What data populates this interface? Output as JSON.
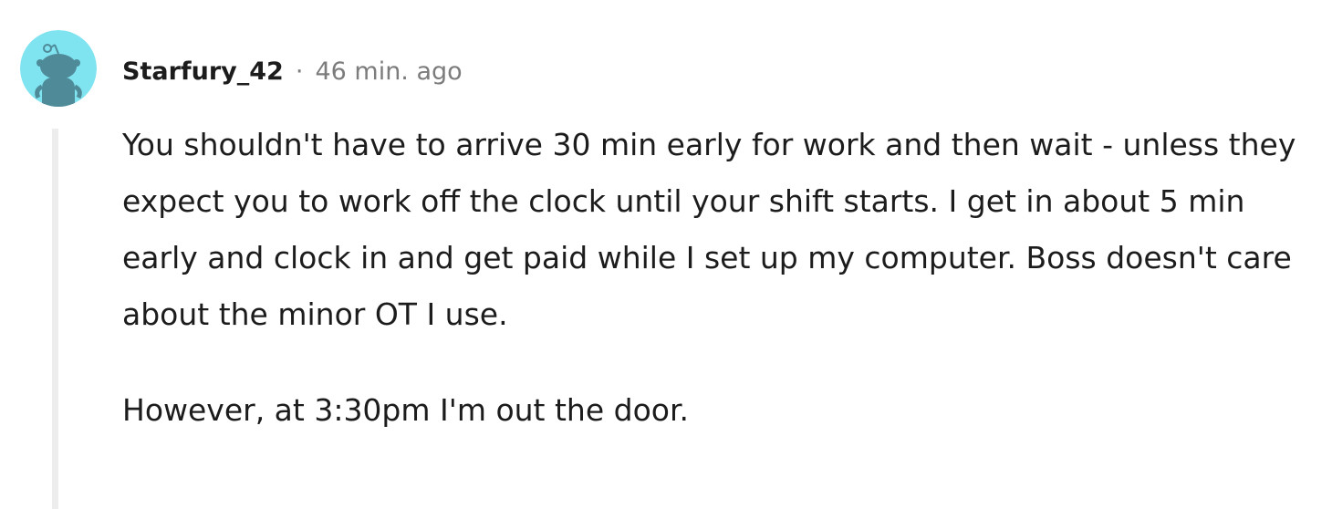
{
  "comment": {
    "author": "Starfury_42",
    "separator": "·",
    "timestamp": "46 min. ago",
    "avatar": {
      "icon": "snoo-avatar-icon",
      "background_color": "#7fe3f0",
      "figure_color": "#4f8a99"
    },
    "paragraphs": [
      "You shouldn't have to arrive 30 min early for work and then wait - unless they expect you to work off the clock until your shift starts. I get in about 5 min early and clock in and get paid while I set up my computer. Boss doesn't care about the minor OT I use.",
      "However, at 3:30pm I'm out the door."
    ]
  },
  "colors": {
    "text": "#1c1c1c",
    "meta": "#7c7c7c",
    "thread_line": "#ededed"
  }
}
